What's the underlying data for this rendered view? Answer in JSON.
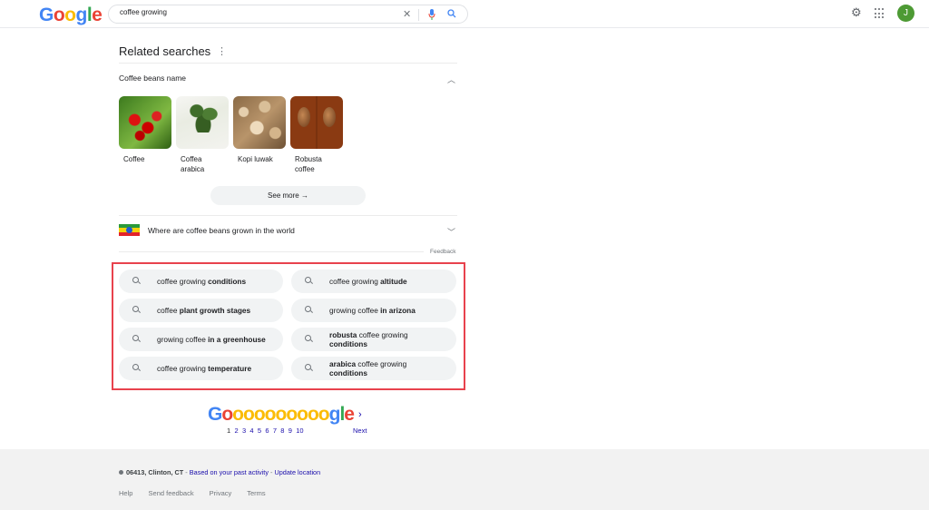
{
  "header": {
    "logo_letters": [
      {
        "ch": "G",
        "color": "#4285f4"
      },
      {
        "ch": "o",
        "color": "#ea4335"
      },
      {
        "ch": "o",
        "color": "#fbbc05"
      },
      {
        "ch": "g",
        "color": "#4285f4"
      },
      {
        "ch": "l",
        "color": "#34a853"
      },
      {
        "ch": "e",
        "color": "#ea4335"
      }
    ],
    "search_value": "coffee growing",
    "clear_icon": "close-icon",
    "mic_icon": "microphone-icon",
    "search_icon": "search-icon",
    "settings_icon": "gear-icon",
    "apps_icon": "apps-grid-icon",
    "avatar_initial": "J",
    "avatar_color": "#4d9a34"
  },
  "related": {
    "title": "Related searches",
    "group": {
      "title": "Coffee beans name",
      "items": [
        {
          "label": "Coffee"
        },
        {
          "label": "Coffea arabica"
        },
        {
          "label": "Kopi luwak"
        },
        {
          "label": "Robusta coffee"
        }
      ],
      "see_more": "See more"
    },
    "collapsed_group": {
      "title": "Where are coffee beans grown in the world"
    },
    "feedback": "Feedback"
  },
  "suggestions": [
    {
      "plain": "coffee growing ",
      "bold": "conditions",
      "after": ""
    },
    {
      "plain": "coffee growing ",
      "bold": "altitude",
      "after": ""
    },
    {
      "plain": "coffee ",
      "bold": "plant growth stages",
      "after": ""
    },
    {
      "plain": "growing coffee ",
      "bold": "in arizona",
      "after": ""
    },
    {
      "plain": "growing coffee ",
      "bold": "in a greenhouse",
      "after": ""
    },
    {
      "plain": "",
      "bold": "robusta",
      "after": " coffee growing ",
      "bold2": "conditions"
    },
    {
      "plain": "coffee growing ",
      "bold": "temperature",
      "after": ""
    },
    {
      "plain": "",
      "bold": "arabica",
      "after": " coffee growing ",
      "bold2": "conditions"
    }
  ],
  "pagination": {
    "letters": [
      {
        "ch": "G",
        "color": "#4285f4"
      },
      {
        "ch": "o",
        "color": "#ea4335"
      },
      {
        "ch": "o",
        "color": "#fbbc05"
      },
      {
        "ch": "o",
        "color": "#fbbc05"
      },
      {
        "ch": "o",
        "color": "#fbbc05"
      },
      {
        "ch": "o",
        "color": "#fbbc05"
      },
      {
        "ch": "o",
        "color": "#fbbc05"
      },
      {
        "ch": "o",
        "color": "#fbbc05"
      },
      {
        "ch": "o",
        "color": "#fbbc05"
      },
      {
        "ch": "o",
        "color": "#fbbc05"
      },
      {
        "ch": "o",
        "color": "#fbbc05"
      },
      {
        "ch": "g",
        "color": "#4285f4"
      },
      {
        "ch": "l",
        "color": "#34a853"
      },
      {
        "ch": "e",
        "color": "#ea4335"
      }
    ],
    "pages": [
      "1",
      "2",
      "3",
      "4",
      "5",
      "6",
      "7",
      "8",
      "9",
      "10"
    ],
    "current": "1",
    "next": "Next"
  },
  "footer": {
    "location": "06413, Clinton, CT",
    "sep": " - ",
    "based_on": "Based on your past activity",
    "update": "Update location",
    "links": [
      "Help",
      "Send feedback",
      "Privacy",
      "Terms"
    ]
  }
}
